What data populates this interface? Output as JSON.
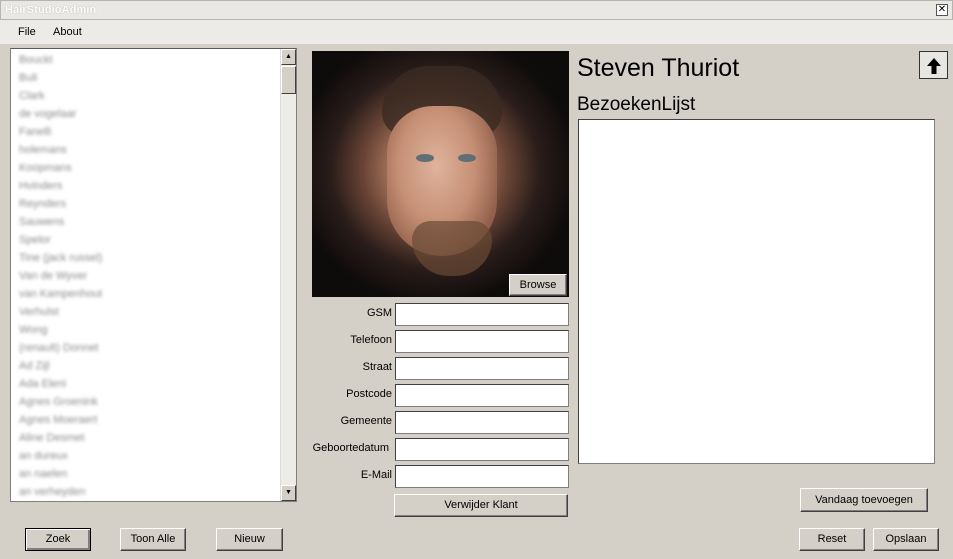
{
  "window": {
    "title": "HairStudioAdmin",
    "close_glyph": "✕"
  },
  "menu": {
    "file": "File",
    "about": "About"
  },
  "clients": [
    "Bouckt",
    "Buli",
    "Clark",
    "de vogelaar",
    "Fanelli",
    "holemans",
    "Koopmans",
    "Hvinders",
    "Reynders",
    "Sauwens",
    "Spelor",
    "Tine (jack russel)",
    "Van de Wyver",
    "van Kampenhout",
    "Verhulst",
    "Wong",
    "(renault) Donnet",
    "Ad Zijl",
    "Ada Eleni",
    "Agnes Groenink",
    "Agnes Moeraert",
    "Aline Desmet",
    "an dureux",
    "an naelen",
    "an verheyden"
  ],
  "photo": {
    "browse_label": "Browse"
  },
  "form": {
    "gsm": "GSM",
    "telefoon": "Telefoon",
    "straat": "Straat",
    "postcode": "Postcode",
    "gemeente": "Gemeente",
    "geboortedatum": "Geboortedatum",
    "email": "E-Mail",
    "values": {
      "gsm": "",
      "telefoon": "",
      "straat": "",
      "postcode": "",
      "gemeente": "",
      "geboortedatum": "",
      "email": ""
    },
    "delete_label": "Verwijder Klant"
  },
  "detail": {
    "name": "Steven Thuriot",
    "visits_heading": "BezoekenLijst"
  },
  "buttons": {
    "add_today": "Vandaag toevoegen",
    "search": "Zoek",
    "show_all": "Toon Alle",
    "new": "Nieuw",
    "reset": "Reset",
    "save": "Opslaan"
  },
  "icons": {
    "up": "arrow-up-icon",
    "close": "close-icon"
  }
}
